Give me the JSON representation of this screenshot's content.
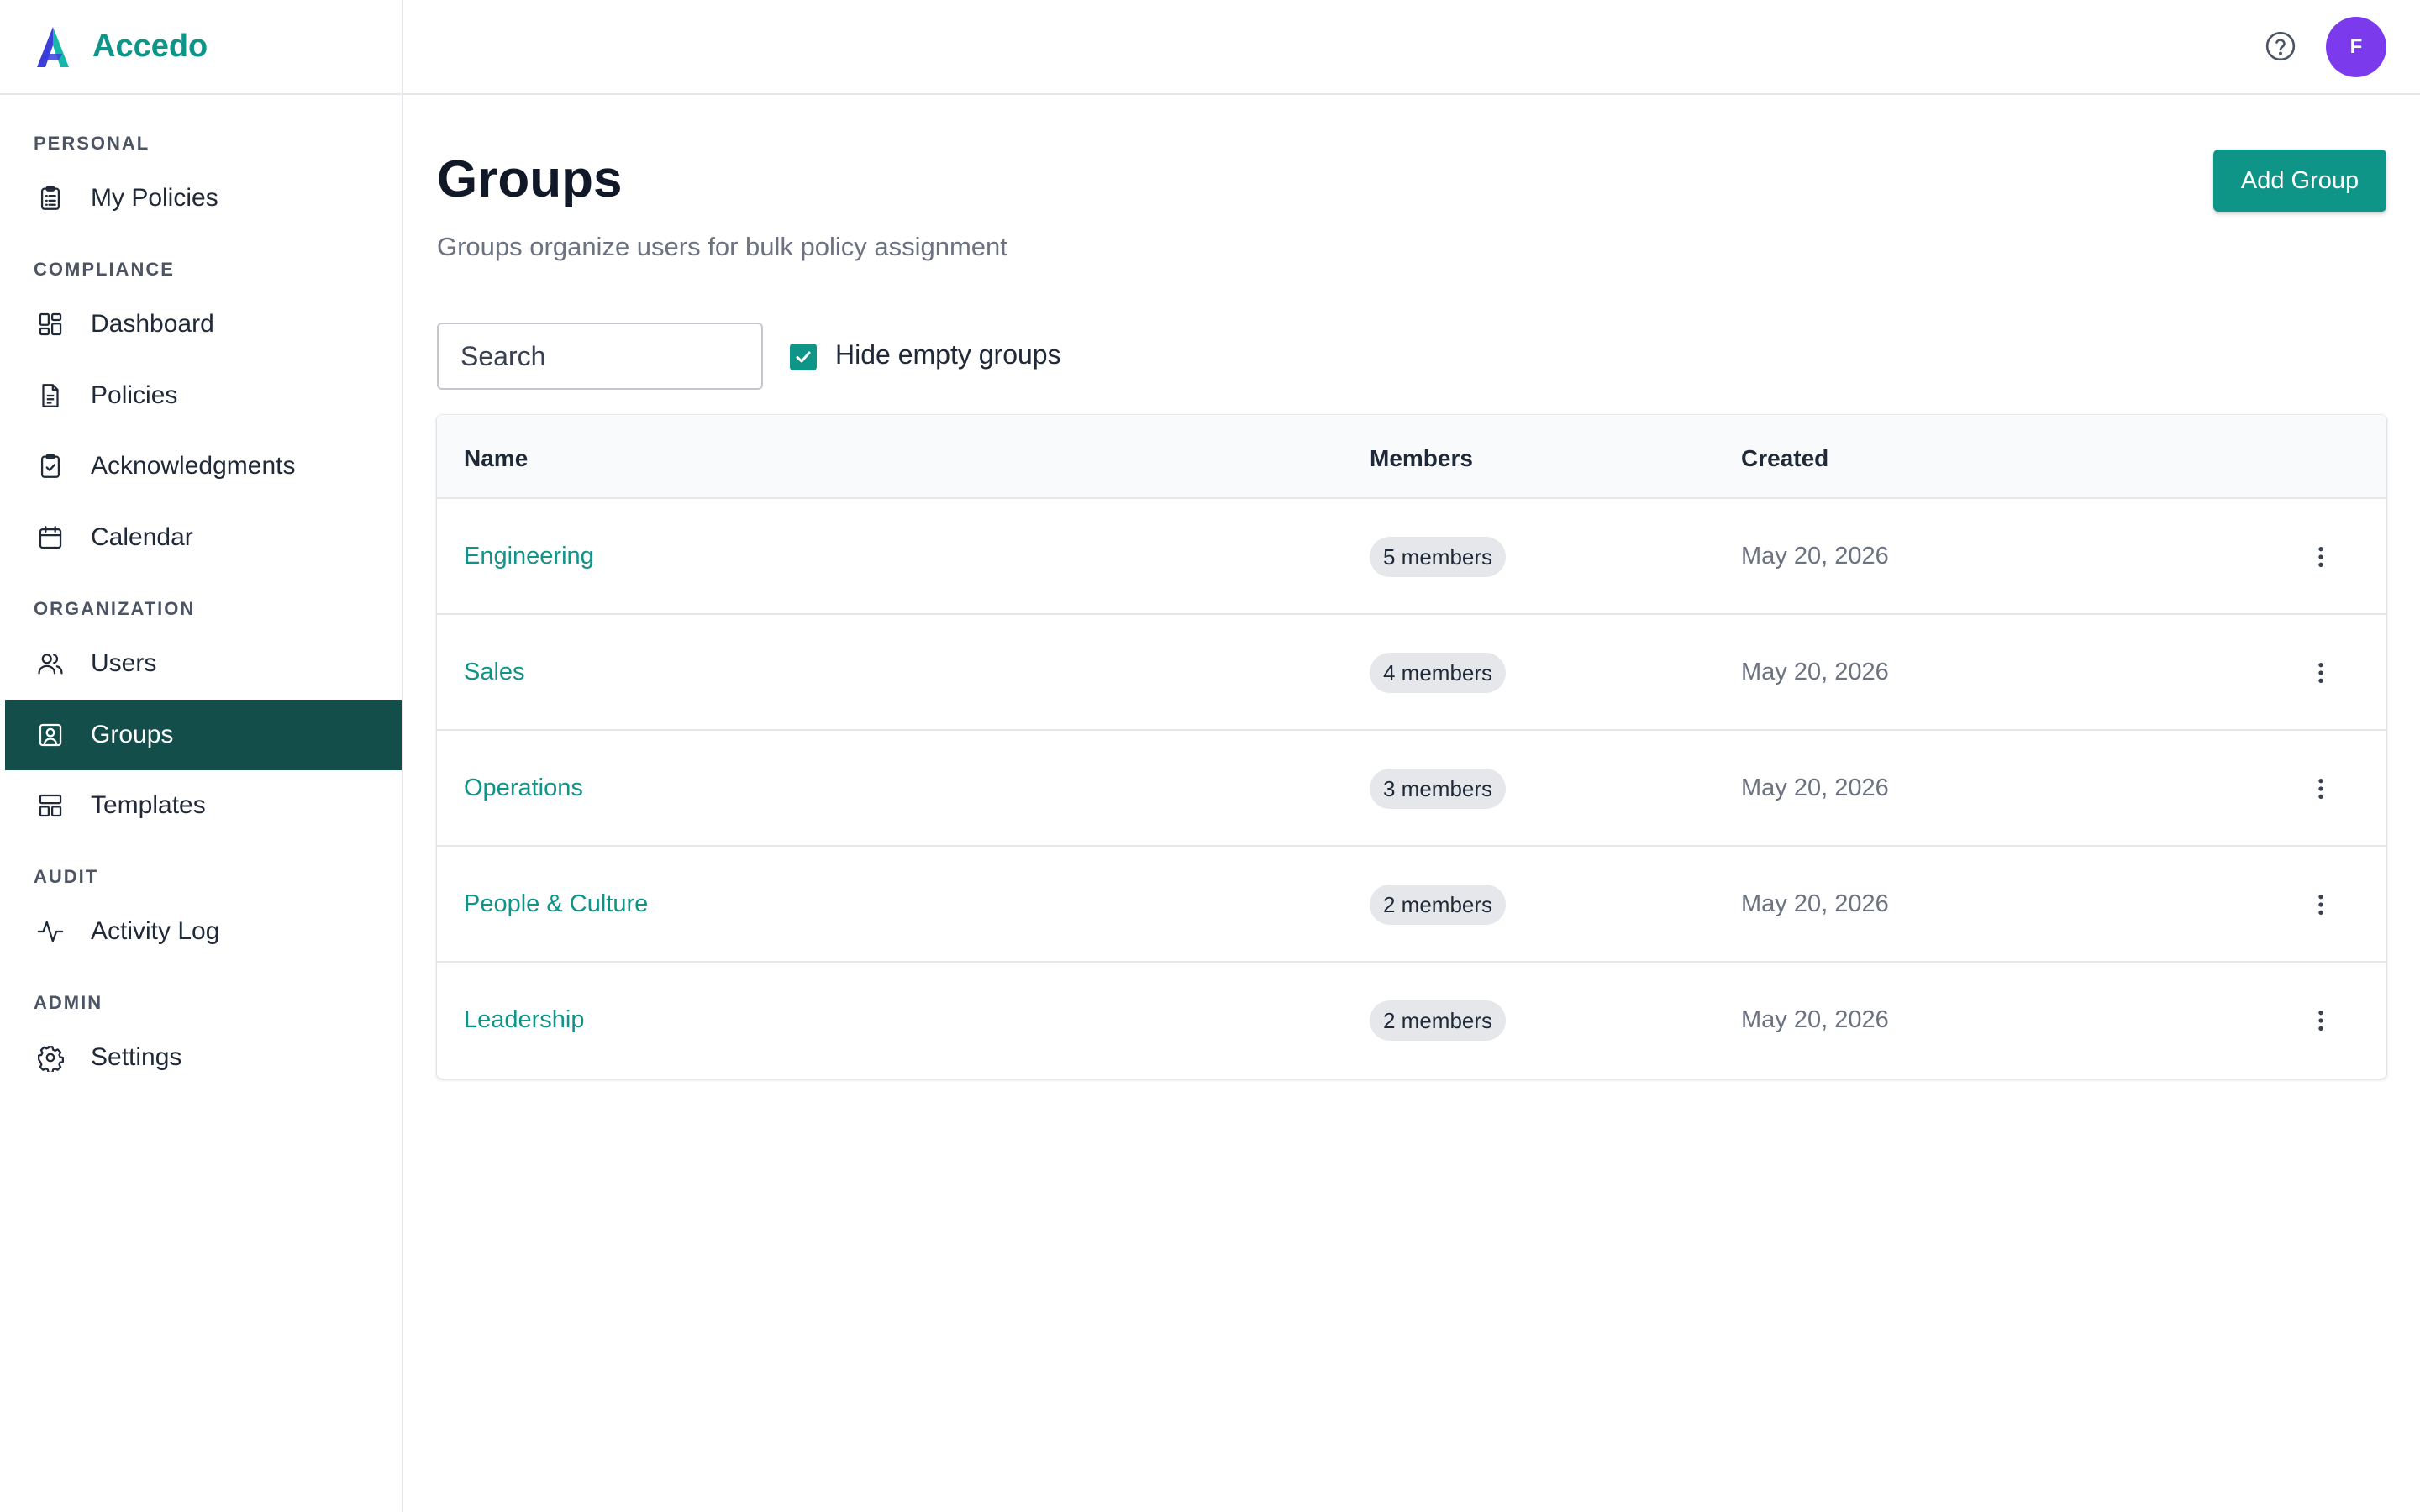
{
  "brand": {
    "name": "Accedo"
  },
  "sidebar": {
    "sections": [
      {
        "label": "PERSONAL"
      },
      {
        "label": "COMPLIANCE"
      },
      {
        "label": "ORGANIZATION"
      },
      {
        "label": "AUDIT"
      },
      {
        "label": "ADMIN"
      }
    ],
    "items": [
      {
        "label": "My Policies",
        "icon": "clipboard-list-icon"
      },
      {
        "label": "Dashboard",
        "icon": "dashboard-grid-icon"
      },
      {
        "label": "Policies",
        "icon": "document-icon"
      },
      {
        "label": "Acknowledgments",
        "icon": "clipboard-check-icon"
      },
      {
        "label": "Calendar",
        "icon": "calendar-icon"
      },
      {
        "label": "Users",
        "icon": "users-icon"
      },
      {
        "label": "Groups",
        "icon": "group-portrait-icon",
        "active": true
      },
      {
        "label": "Templates",
        "icon": "templates-layout-icon"
      },
      {
        "label": "Activity Log",
        "icon": "activity-pulse-icon"
      },
      {
        "label": "Settings",
        "icon": "gear-icon"
      }
    ]
  },
  "header": {
    "avatar_initial": "F",
    "colors": {
      "brand": "#0f9488",
      "active_nav": "#134e4a",
      "avatar": "#7c3aed"
    }
  },
  "main": {
    "title": "Groups",
    "subtitle": "Groups organize users for bulk policy assignment",
    "add_button": "Add Group",
    "search_placeholder": "Search",
    "hide_empty_label": "Hide empty groups",
    "hide_empty_checked": true
  },
  "table": {
    "columns": [
      "Name",
      "Members",
      "Created"
    ],
    "rows": [
      {
        "name": "Engineering",
        "members": "5 members",
        "created": "May 20, 2026"
      },
      {
        "name": "Sales",
        "members": "4 members",
        "created": "May 20, 2026"
      },
      {
        "name": "Operations",
        "members": "3 members",
        "created": "May 20, 2026"
      },
      {
        "name": "People & Culture",
        "members": "2 members",
        "created": "May 20, 2026"
      },
      {
        "name": "Leadership",
        "members": "2 members",
        "created": "May 20, 2026"
      }
    ]
  }
}
